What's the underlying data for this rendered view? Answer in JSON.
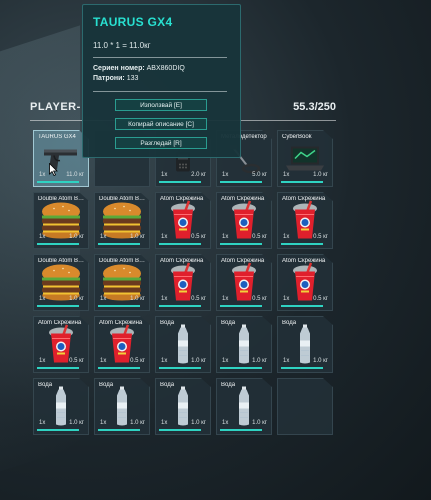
{
  "inventory": {
    "title": "PLAYER-",
    "weight": "55.3/250",
    "slots": [
      {
        "name": "TAURUS GX4",
        "count": "1x",
        "weight": "11.0 кг",
        "icon": "pistol",
        "selected": true
      },
      {
        "name": "",
        "count": "",
        "weight": "",
        "icon": "none",
        "selected": false
      },
      {
        "name": "",
        "count": "1x",
        "weight": "2.0 кг",
        "icon": "radio",
        "selected": false
      },
      {
        "name": "Металодетектор",
        "count": "1x",
        "weight": "5.0 кг",
        "icon": "detector",
        "selected": false
      },
      {
        "name": "CyberBook",
        "count": "1x",
        "weight": "1.0 кг",
        "icon": "laptop",
        "selected": false
      },
      {
        "name": "Double Atom Burger",
        "count": "1x",
        "weight": "1.0 кг",
        "icon": "burger",
        "selected": false
      },
      {
        "name": "Double Atom Burger",
        "count": "1x",
        "weight": "1.0 кг",
        "icon": "burger",
        "selected": false
      },
      {
        "name": "Atom Скрежина",
        "count": "1x",
        "weight": "0.5 кг",
        "icon": "slush",
        "selected": false
      },
      {
        "name": "Atom Скрежина",
        "count": "1x",
        "weight": "0.5 кг",
        "icon": "slush",
        "selected": false
      },
      {
        "name": "Atom Скрежина",
        "count": "1x",
        "weight": "0.5 кг",
        "icon": "slush",
        "selected": false
      },
      {
        "name": "Double Atom Burger",
        "count": "1x",
        "weight": "1.0 кг",
        "icon": "burger",
        "selected": false
      },
      {
        "name": "Double Atom Burger",
        "count": "1x",
        "weight": "1.0 кг",
        "icon": "burger",
        "selected": false
      },
      {
        "name": "Atom Скрежина",
        "count": "1x",
        "weight": "0.5 кг",
        "icon": "slush",
        "selected": false
      },
      {
        "name": "Atom Скрежина",
        "count": "1x",
        "weight": "0.5 кг",
        "icon": "slush",
        "selected": false
      },
      {
        "name": "Atom Скрежина",
        "count": "1x",
        "weight": "0.5 кг",
        "icon": "slush",
        "selected": false
      },
      {
        "name": "Atom Скрежина",
        "count": "1x",
        "weight": "0.5 кг",
        "icon": "slush",
        "selected": false
      },
      {
        "name": "Atom Скрежина",
        "count": "1x",
        "weight": "0.5 кг",
        "icon": "slush",
        "selected": false
      },
      {
        "name": "Вода",
        "count": "1x",
        "weight": "1.0 кг",
        "icon": "water",
        "selected": false
      },
      {
        "name": "Вода",
        "count": "1x",
        "weight": "1.0 кг",
        "icon": "water",
        "selected": false
      },
      {
        "name": "Вода",
        "count": "1x",
        "weight": "1.0 кг",
        "icon": "water",
        "selected": false
      },
      {
        "name": "Вода",
        "count": "1x",
        "weight": "1.0 кг",
        "icon": "water",
        "selected": false
      },
      {
        "name": "Вода",
        "count": "1x",
        "weight": "1.0 кг",
        "icon": "water",
        "selected": false
      },
      {
        "name": "Вода",
        "count": "1x",
        "weight": "1.0 кг",
        "icon": "water",
        "selected": false
      },
      {
        "name": "Вода",
        "count": "1x",
        "weight": "1.0 кг",
        "icon": "water",
        "selected": false
      },
      {
        "name": "",
        "count": "",
        "weight": "",
        "icon": "none",
        "selected": false
      }
    ]
  },
  "tooltip": {
    "title": "TAURUS GX4",
    "formula": "11.0 * 1 = 11.0кг",
    "serial_label": "Сериен номер:",
    "serial_value": "ABX860DIQ",
    "ammo_label": "Патрони:",
    "ammo_value": "133",
    "use_label": "Използвай [E]",
    "copy_label": "Копирай описание [C]",
    "inspect_label": "Разгледай [R]"
  },
  "colors": {
    "accent": "#28e0d0",
    "bar": "#2fd3c2"
  }
}
